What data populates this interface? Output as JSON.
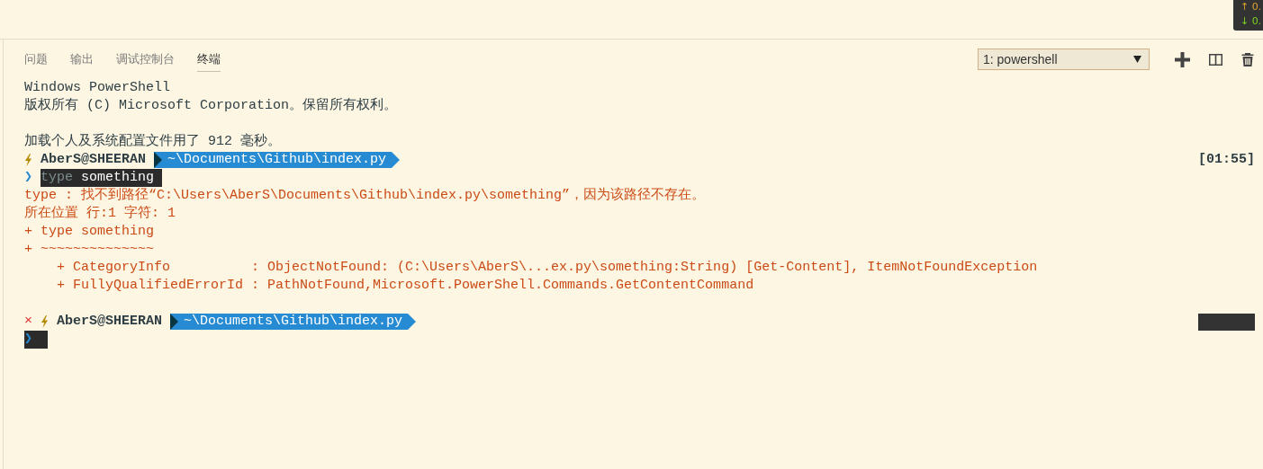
{
  "network_widget": {
    "upload": "↑ 0.",
    "download": "↓ 0."
  },
  "panel": {
    "tabs": [
      {
        "label": "问题",
        "selected": false
      },
      {
        "label": "输出",
        "selected": false
      },
      {
        "label": "调试控制台",
        "selected": false
      },
      {
        "label": "终端",
        "selected": true
      }
    ],
    "terminal_select": {
      "value": "1: powershell"
    }
  },
  "terminal": {
    "lines": [
      {
        "kind": "text",
        "text": "Windows PowerShell"
      },
      {
        "kind": "text",
        "text": "版权所有 (C) Microsoft Corporation。保留所有权利。"
      },
      {
        "kind": "blank"
      },
      {
        "kind": "text",
        "text": "加载个人及系统配置文件用了 912 毫秒。"
      },
      {
        "kind": "prompt",
        "user": "AberS@SHEERAN",
        "path": "~\\Documents\\Github\\index.py",
        "time": "[01:55]"
      },
      {
        "kind": "input",
        "chevron": "❯",
        "command": "type",
        "argument": "something",
        "cursor": false
      },
      {
        "kind": "error",
        "text": "type : 找不到路径“C:\\Users\\AberS\\Documents\\Github\\index.py\\something”，因为该路径不存在。"
      },
      {
        "kind": "error",
        "text": "所在位置 行:1 字符: 1"
      },
      {
        "kind": "error",
        "text": "+ type something"
      },
      {
        "kind": "error",
        "text": "+ ~~~~~~~~~~~~~~"
      },
      {
        "kind": "error",
        "text": "    + CategoryInfo          : ObjectNotFound: (C:\\Users\\AberS\\...ex.py\\something:String) [Get-Content], ItemNotFoundException"
      },
      {
        "kind": "error",
        "text": "    + FullyQualifiedErrorId : PathNotFound,Microsoft.PowerShell.Commands.GetContentCommand"
      },
      {
        "kind": "blank"
      },
      {
        "kind": "prompt",
        "status": "×",
        "user": "AberS@SHEERAN",
        "path": "~\\Documents\\Github\\index.py",
        "time_hidden": true
      },
      {
        "kind": "input",
        "chevron": "❯",
        "cursor": true
      }
    ]
  }
}
